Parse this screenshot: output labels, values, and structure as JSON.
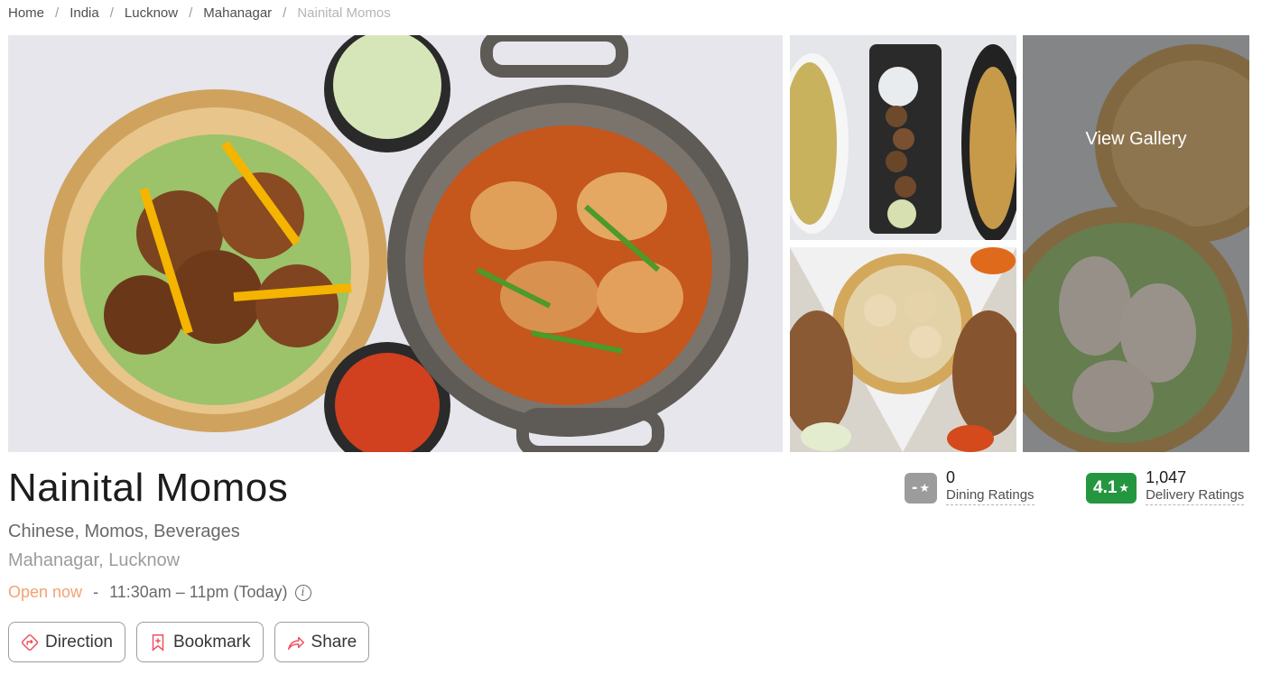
{
  "breadcrumb": {
    "items": [
      "Home",
      "India",
      "Lucknow",
      "Mahanagar"
    ],
    "current": "Nainital Momos",
    "separator": "/"
  },
  "gallery": {
    "view_gallery_label": "View Gallery"
  },
  "restaurant": {
    "name": "Nainital Momos",
    "cuisines": "Chinese, Momos, Beverages",
    "locality": "Mahanagar, Lucknow",
    "status": "Open now",
    "hours": "11:30am – 11pm (Today)",
    "hours_separator": "-"
  },
  "ratings": {
    "dining": {
      "score": "-",
      "count": "0",
      "label": "Dining Ratings",
      "color": "#9c9c9c"
    },
    "delivery": {
      "score": "4.1",
      "count": "1,047",
      "label": "Delivery Ratings",
      "color": "#24963f"
    }
  },
  "actions": {
    "direction": "Direction",
    "bookmark": "Bookmark",
    "share": "Share"
  },
  "colors": {
    "accent": "#ef4f5f",
    "open": "#f4a172"
  }
}
